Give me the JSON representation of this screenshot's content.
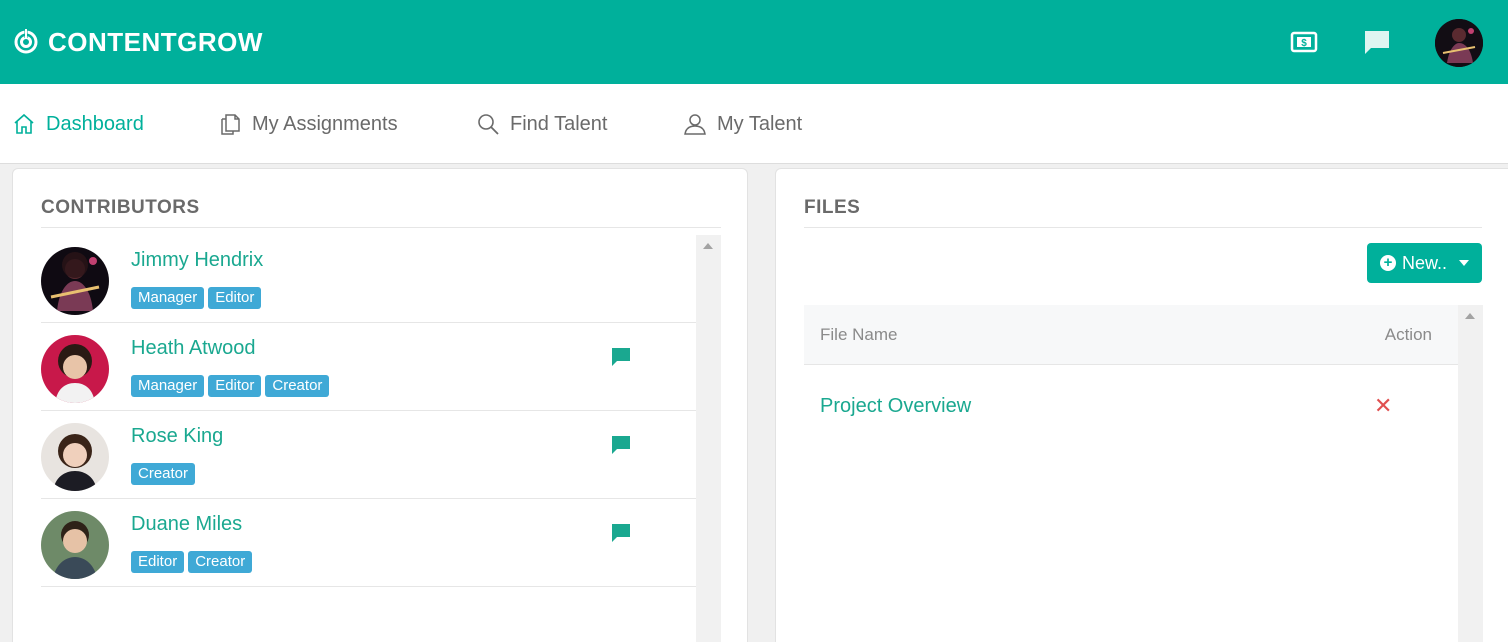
{
  "app": {
    "brand": "CONTENTGROW"
  },
  "nav": {
    "items": [
      {
        "label": "Dashboard",
        "icon": "home-icon",
        "active": true
      },
      {
        "label": "My Assignments",
        "icon": "documents-icon"
      },
      {
        "label": "Find Talent",
        "icon": "search-icon"
      },
      {
        "label": "My Talent",
        "icon": "user-icon"
      }
    ]
  },
  "contributors": {
    "title": "CONTRIBUTORS",
    "people": [
      {
        "name": "Jimmy Hendrix",
        "roles": [
          "Manager",
          "Editor"
        ],
        "chat": false
      },
      {
        "name": "Heath Atwood",
        "roles": [
          "Manager",
          "Editor",
          "Creator"
        ],
        "chat": true
      },
      {
        "name": "Rose King",
        "roles": [
          "Creator"
        ],
        "chat": true
      },
      {
        "name": "Duane Miles",
        "roles": [
          "Editor",
          "Creator"
        ],
        "chat": true
      }
    ]
  },
  "files": {
    "title": "FILES",
    "new_label": "New..",
    "columns": {
      "name": "File Name",
      "action": "Action"
    },
    "rows": [
      {
        "name": "Project Overview",
        "action": "✕"
      }
    ]
  },
  "colors": {
    "brand": "#00b09b",
    "badge": "#3fa9d6",
    "link": "#1aa890",
    "delete": "#e05050"
  }
}
